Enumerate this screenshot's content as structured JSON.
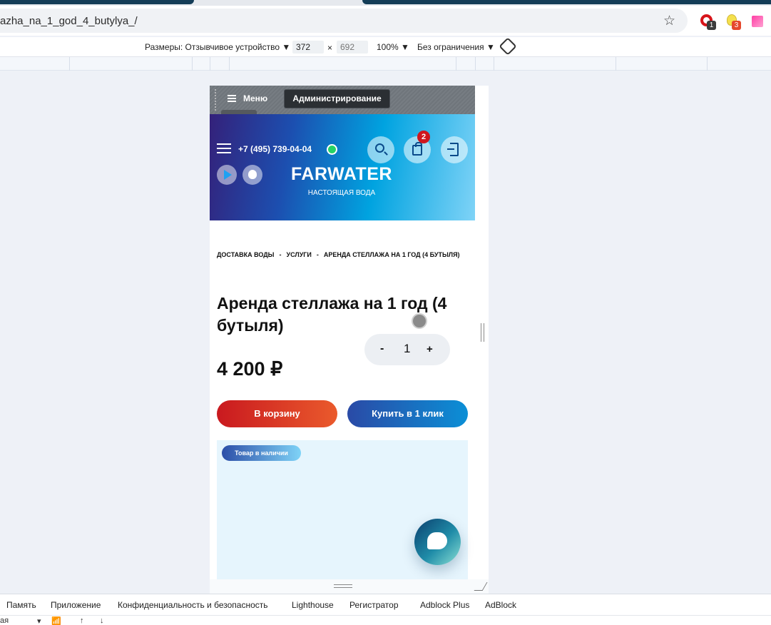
{
  "browser": {
    "url": "azha_na_1_god_4_butylya_/",
    "extensions": [
      {
        "name": "opera-adblock-icon",
        "count": "1"
      },
      {
        "name": "bulb-extension-icon",
        "count": "3"
      },
      {
        "name": "pink-extension-icon",
        "count": ""
      }
    ]
  },
  "device_toolbar": {
    "dimensions_label": "Размеры: Отзывчивое устройство ▼",
    "width": "372",
    "times": "×",
    "height": "692",
    "zoom": "100% ▼",
    "throttle": "Без ограничения ▼"
  },
  "admin_bar": {
    "menu_label": "Меню",
    "admin_button": "Администрирование"
  },
  "header": {
    "phone": "+7 (495) 739-04-04",
    "cart_count": "2",
    "logo": "FARWATER",
    "tagline": "НАСТОЯЩАЯ ВОДА"
  },
  "breadcrumb": {
    "items": [
      "ДОСТАВКА ВОДЫ",
      "УСЛУГИ",
      "АРЕНДА СТЕЛЛАЖА НА 1 ГОД (4 БУТЫЛЯ)"
    ],
    "separator": "-"
  },
  "product": {
    "title": "Аренда стеллажа на 1 год (4 бутыля)",
    "price": "4 200 ₽",
    "qty_minus": "-",
    "quantity": "1",
    "qty_plus": "+",
    "cart_button": "В корзину",
    "buy_button": "Купить в 1 клик",
    "stock_badge": "Товар в наличии"
  },
  "devtools": {
    "tabs": [
      "Память",
      "Приложение",
      "Конфиденциальность и безопасность",
      "Lighthouse",
      "Регистратор",
      "Adblock Plus",
      "AdBlock"
    ],
    "foot": [
      "ая",
      "▾",
      "↑",
      "↓"
    ]
  },
  "colors": {
    "cart_button": "#d0161e",
    "buy_button": "#1f64b8",
    "header_start": "#34217a",
    "header_end": "#7fd3f7"
  }
}
